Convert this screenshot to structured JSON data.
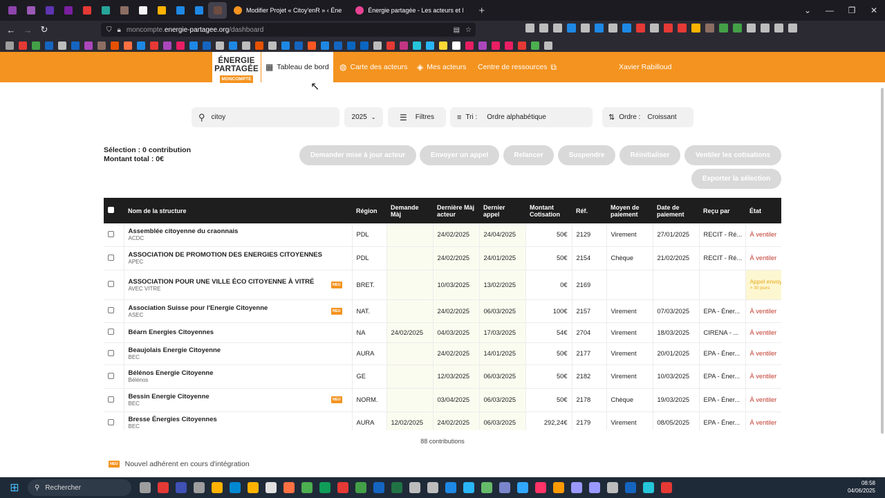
{
  "browser": {
    "tabs": [
      {
        "title": "Modifier Projet « Citoy'enR » ‹ Éne",
        "color": "#f4931f"
      },
      {
        "title": "Énergie partagée - Les acteurs et l",
        "color": "#e84393"
      }
    ],
    "new_tab_label": "+",
    "url_muted_prefix": "moncompte.",
    "url_host": "energie-partagee.org",
    "url_path": "/dashboard",
    "window_controls": [
      "⌄",
      "—",
      "❐",
      "✕"
    ],
    "pinned_colors": [
      "#8e44ad",
      "#9b59b6",
      "#5e35b1",
      "#7b1fa2",
      "#e53935",
      "#26a69a",
      "#8d6e63",
      "#f5f5f5",
      "#ffb300",
      "#1e88e5",
      "#1e88e5",
      "#6d4c41"
    ],
    "bookmark_colors": [
      "#9e9e9e",
      "#e53935",
      "#43a047",
      "#1565c0",
      "#bdbdbd",
      "#1565c0",
      "#ab47bc",
      "#8d6e63",
      "#e65100",
      "#ff7043",
      "#1e88e5",
      "#e53935",
      "#ab47bc",
      "#e91e63",
      "#1e88e5",
      "#1565c0",
      "#bdbdbd",
      "#1e88e5",
      "#bdbdbd",
      "#e65100",
      "#bdbdbd",
      "#1e88e5",
      "#1565c0",
      "#ff5722",
      "#1e88e5",
      "#1565c0",
      "#0a66c2",
      "#0a66c2",
      "#bdbdbd",
      "#e53935",
      "#c13584",
      "#26c6da",
      "#29b6f6",
      "#fdd835",
      "#ffffff",
      "#e91e63",
      "#ab47bc",
      "#e91e63",
      "#e91e63",
      "#e53935",
      "#4caf50",
      "#bdbdbd"
    ]
  },
  "header": {
    "logo_line1": "ÉNERGIE",
    "logo_line2": "PARTAGÉE",
    "logo_badge": "MONCOMPTE",
    "nav": {
      "dashboard": "Tableau de bord",
      "map": "Carte des acteurs",
      "my_actors": "Mes acteurs",
      "resources": "Centre de ressources",
      "user": "Xavier Rabilloud"
    }
  },
  "filters": {
    "search_value": "citoy",
    "year": "2025",
    "filters_label": "Filtres",
    "sort_label": "Tri :",
    "sort_value": "Ordre alphabétique",
    "order_label": "Ordre :",
    "order_value": "Croissant"
  },
  "selection": {
    "line1": "Sélection : 0 contribution",
    "line2": "Montant total : 0€"
  },
  "actions": {
    "update": "Demander mise à jour acteur",
    "send_call": "Envoyer un appel",
    "remind": "Relancer",
    "suspend": "Suspendre",
    "reset": "Réinitialiser",
    "split": "Ventiler les cotisations",
    "export": "Exporter la sélection"
  },
  "table": {
    "headers": {
      "name": "Nom de la structure",
      "region": "Région",
      "request": "Demande Màj",
      "last_update": "Dernière Màj acteur",
      "last_call": "Dernier appel",
      "amount": "Montant Cotisation",
      "ref": "Réf.",
      "method": "Moyen de paiement",
      "date": "Date de paiement",
      "received": "Reçu par",
      "state": "État"
    },
    "new_badge": "NEU",
    "rows": [
      {
        "name": "Assemblée citoyenne du craonnais",
        "abbr": "ACDC",
        "region": "PDL",
        "request": "",
        "last_update": "24/02/2025",
        "last_call": "24/04/2025",
        "amount": "50€",
        "ref": "2129",
        "method": "Virement",
        "date": "27/01/2025",
        "received": "RECIT - Ré...",
        "state": "À ventiler",
        "is_new": false
      },
      {
        "name": "ASSOCIATION DE PROMOTION DES ENERGIES CITOYENNES",
        "abbr": "APEC",
        "region": "PDL",
        "request": "",
        "last_update": "24/02/2025",
        "last_call": "24/01/2025",
        "amount": "50€",
        "ref": "2154",
        "method": "Chèque",
        "date": "21/02/2025",
        "received": "RECIT - Ré...",
        "state": "À ventiler",
        "is_new": false
      },
      {
        "name": "ASSOCIATION POUR UNE VILLE ÉCO CITOYENNE À VITRÉ",
        "abbr": "AVEC VITRE",
        "region": "BRET.",
        "request": "",
        "last_update": "10/03/2025",
        "last_call": "13/02/2025",
        "amount": "0€",
        "ref": "2169",
        "method": "",
        "date": "",
        "received": "",
        "state": "Appel envoyé",
        "state_sub": "> 30 jours",
        "is_new": true
      },
      {
        "name": "Association Suisse pour l'Energie Citoyenne",
        "abbr": "ASEC",
        "region": "NAT.",
        "request": "",
        "last_update": "24/02/2025",
        "last_call": "06/03/2025",
        "amount": "100€",
        "ref": "2157",
        "method": "Virement",
        "date": "07/03/2025",
        "received": "EPA - Éner...",
        "state": "À ventiler",
        "is_new": true
      },
      {
        "name": "Béarn Energies Citoyennes",
        "abbr": "",
        "region": "NA",
        "request": "24/02/2025",
        "last_update": "04/03/2025",
        "last_call": "17/03/2025",
        "amount": "54€",
        "ref": "2704",
        "method": "Virement",
        "date": "18/03/2025",
        "received": "CIRENA - ...",
        "state": "À ventiler",
        "is_new": false
      },
      {
        "name": "Beaujolais Energie Citoyenne",
        "abbr": "BEC",
        "region": "AURA",
        "request": "",
        "last_update": "24/02/2025",
        "last_call": "14/01/2025",
        "amount": "50€",
        "ref": "2177",
        "method": "Virement",
        "date": "20/01/2025",
        "received": "EPA - Éner...",
        "state": "À ventiler",
        "is_new": false
      },
      {
        "name": "Bélénos Energie Citoyenne",
        "abbr": "Bélénos",
        "region": "GE",
        "request": "",
        "last_update": "12/03/2025",
        "last_call": "06/03/2025",
        "amount": "50€",
        "ref": "2182",
        "method": "Virement",
        "date": "10/03/2025",
        "received": "EPA - Éner...",
        "state": "À ventiler",
        "is_new": false
      },
      {
        "name": "Bessin Energie Citoyenne",
        "abbr": "BEC",
        "region": "NORM.",
        "request": "",
        "last_update": "03/04/2025",
        "last_call": "06/03/2025",
        "amount": "50€",
        "ref": "2178",
        "method": "Chèque",
        "date": "19/03/2025",
        "received": "EPA - Éner...",
        "state": "À ventiler",
        "is_new": true
      },
      {
        "name": "Bresse Énergies Citoyennes",
        "abbr": "BEC",
        "region": "AURA",
        "request": "12/02/2025",
        "last_update": "24/02/2025",
        "last_call": "06/03/2025",
        "amount": "292,24€",
        "ref": "2179",
        "method": "Virement",
        "date": "08/05/2025",
        "received": "EPA - Éner...",
        "state": "À ventiler",
        "is_new": false
      }
    ]
  },
  "footer": {
    "count": "88 contributions",
    "legend": "Nouvel adhérent en cours d'intégration"
  },
  "taskbar": {
    "search_label": "Rechercher",
    "time": "08:58",
    "date": "04/06/2025",
    "app_colors": [
      "#9e9e9e",
      "#e53935",
      "#3f51b5",
      "#9e9e9e",
      "#ffb300",
      "#0288d1",
      "#ffb300",
      "#e0e0e0",
      "#ff7043",
      "#4caf50",
      "#0f9d58",
      "#e53935",
      "#43a047",
      "#1565c0",
      "#217346",
      "#bdbdbd",
      "#bdbdbd",
      "#1e88e5",
      "#29b6f6",
      "#66bb6a",
      "#7986cb",
      "#31a8ff",
      "#ff3366",
      "#ff9a00",
      "#9999ff",
      "#9999ff",
      "#bdbdbd",
      "#1565c0",
      "#26c6da",
      "#e53935"
    ]
  }
}
